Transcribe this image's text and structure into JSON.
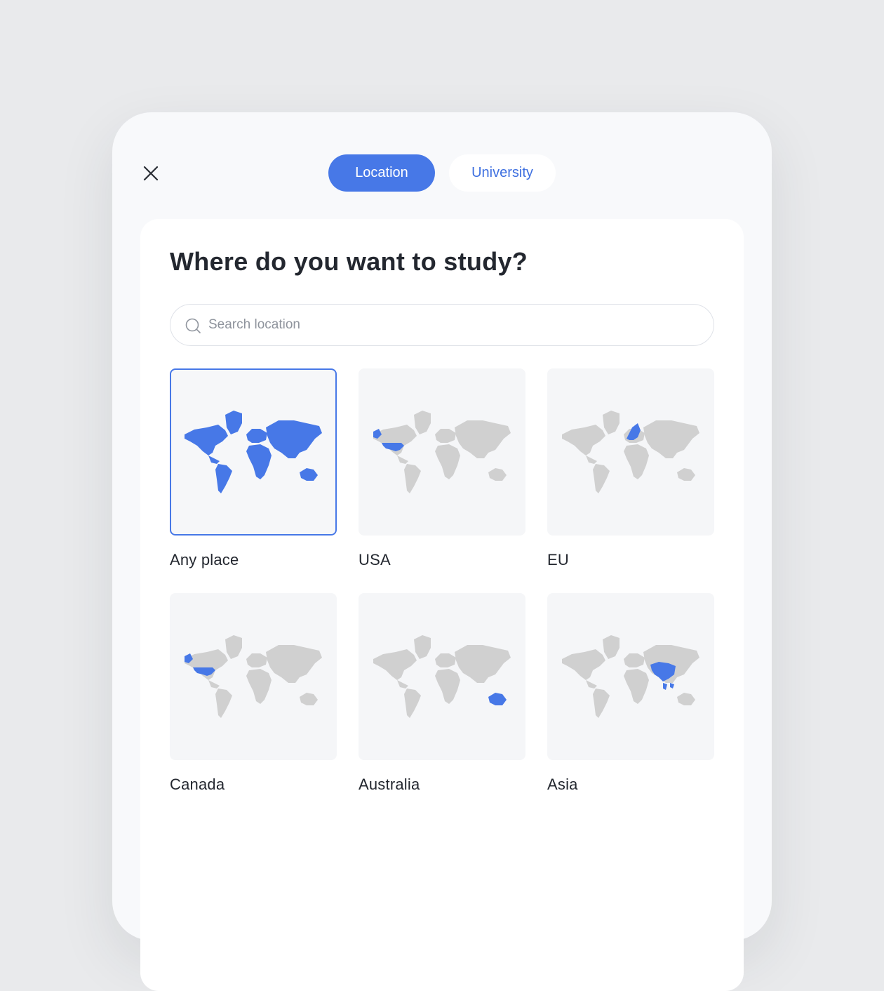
{
  "tabs": [
    {
      "label": "Location",
      "active": true
    },
    {
      "label": "University",
      "active": false
    }
  ],
  "card": {
    "title": "Where do you want to study?"
  },
  "search": {
    "placeholder": "Search location",
    "value": ""
  },
  "locations": [
    {
      "label": "Any place",
      "selected": true,
      "highlight": "all"
    },
    {
      "label": "USA",
      "selected": false,
      "highlight": "usa"
    },
    {
      "label": "EU",
      "selected": false,
      "highlight": "eu"
    },
    {
      "label": "Canada",
      "selected": false,
      "highlight": "usa"
    },
    {
      "label": "Australia",
      "selected": false,
      "highlight": "australia"
    },
    {
      "label": "Asia",
      "selected": false,
      "highlight": "asia"
    }
  ],
  "colors": {
    "accent": "#4778e7",
    "land": "#d0d0d0",
    "background": "#e9eaec"
  }
}
